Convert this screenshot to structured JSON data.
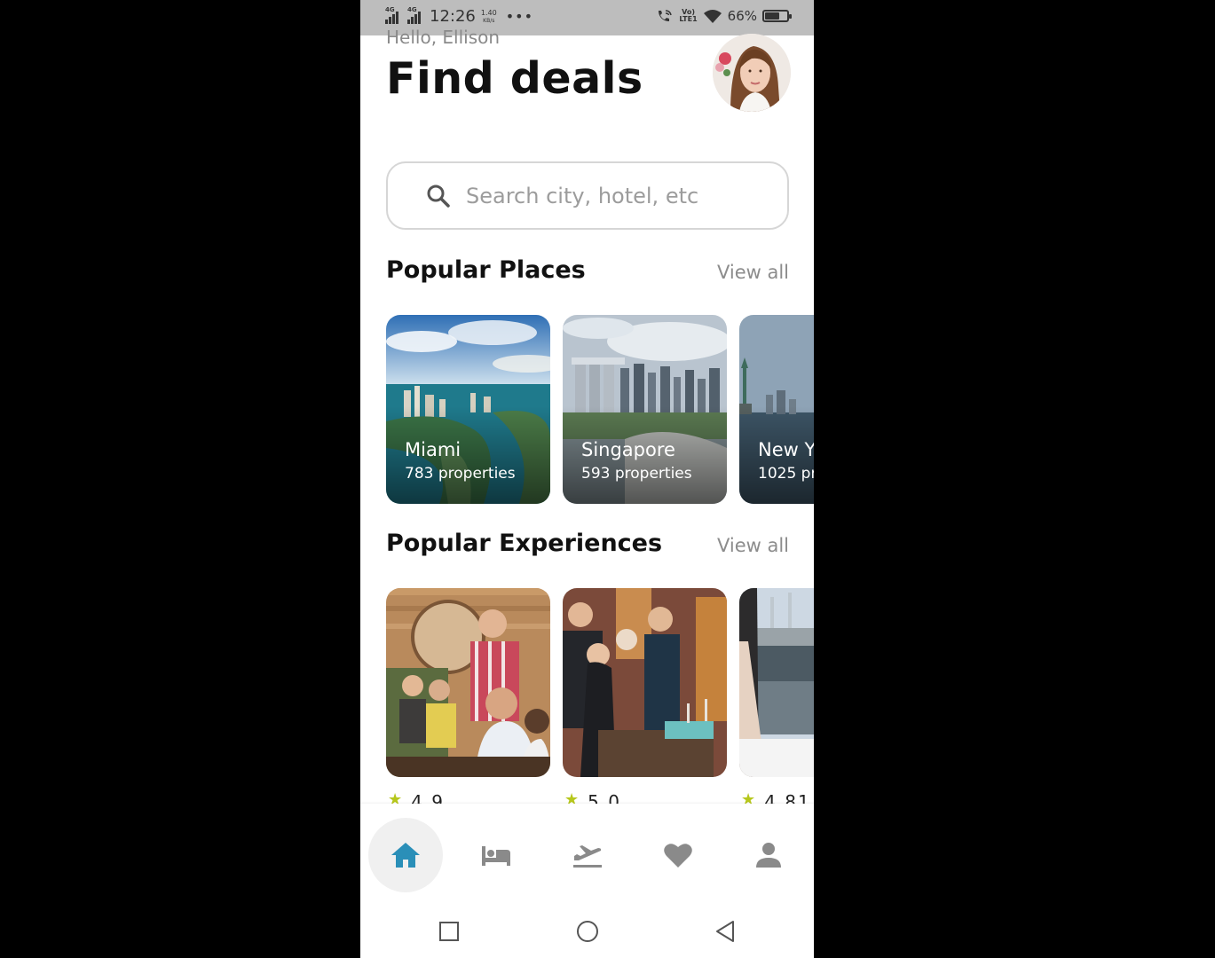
{
  "status_bar": {
    "network_1": "4G",
    "network_2": "4G",
    "time": "12:26",
    "speed_value": "1.40",
    "speed_unit": "KB/s",
    "more": "•••",
    "volte": "Vo)",
    "lte": "LTE1",
    "battery_percent": "66%",
    "battery_level": 0.66
  },
  "header": {
    "greeting": "Hello, Ellison",
    "title": "Find deals"
  },
  "search": {
    "placeholder": "Search city, hotel, etc",
    "value": ""
  },
  "popular_places": {
    "title": "Popular Places",
    "view_all": "View all",
    "items": [
      {
        "name": "Miami",
        "count": "783 properties"
      },
      {
        "name": "Singapore",
        "count": "593 properties"
      },
      {
        "name": "New Y",
        "count": "1025 pr"
      }
    ]
  },
  "popular_experiences": {
    "title": "Popular Experiences",
    "view_all": "View all",
    "items": [
      {
        "rating": "4.9"
      },
      {
        "rating": "5.0"
      },
      {
        "rating": "4.81"
      }
    ]
  },
  "bottom_nav": {
    "items": [
      "home-icon",
      "hotel-bed-icon",
      "flight-icon",
      "heart-icon",
      "person-icon"
    ],
    "active": "home-icon",
    "active_color": "#2a8fb8",
    "inactive_color": "#8a8a8a"
  },
  "system_nav": [
    "recent-apps-icon",
    "home-circle-icon",
    "back-icon"
  ]
}
